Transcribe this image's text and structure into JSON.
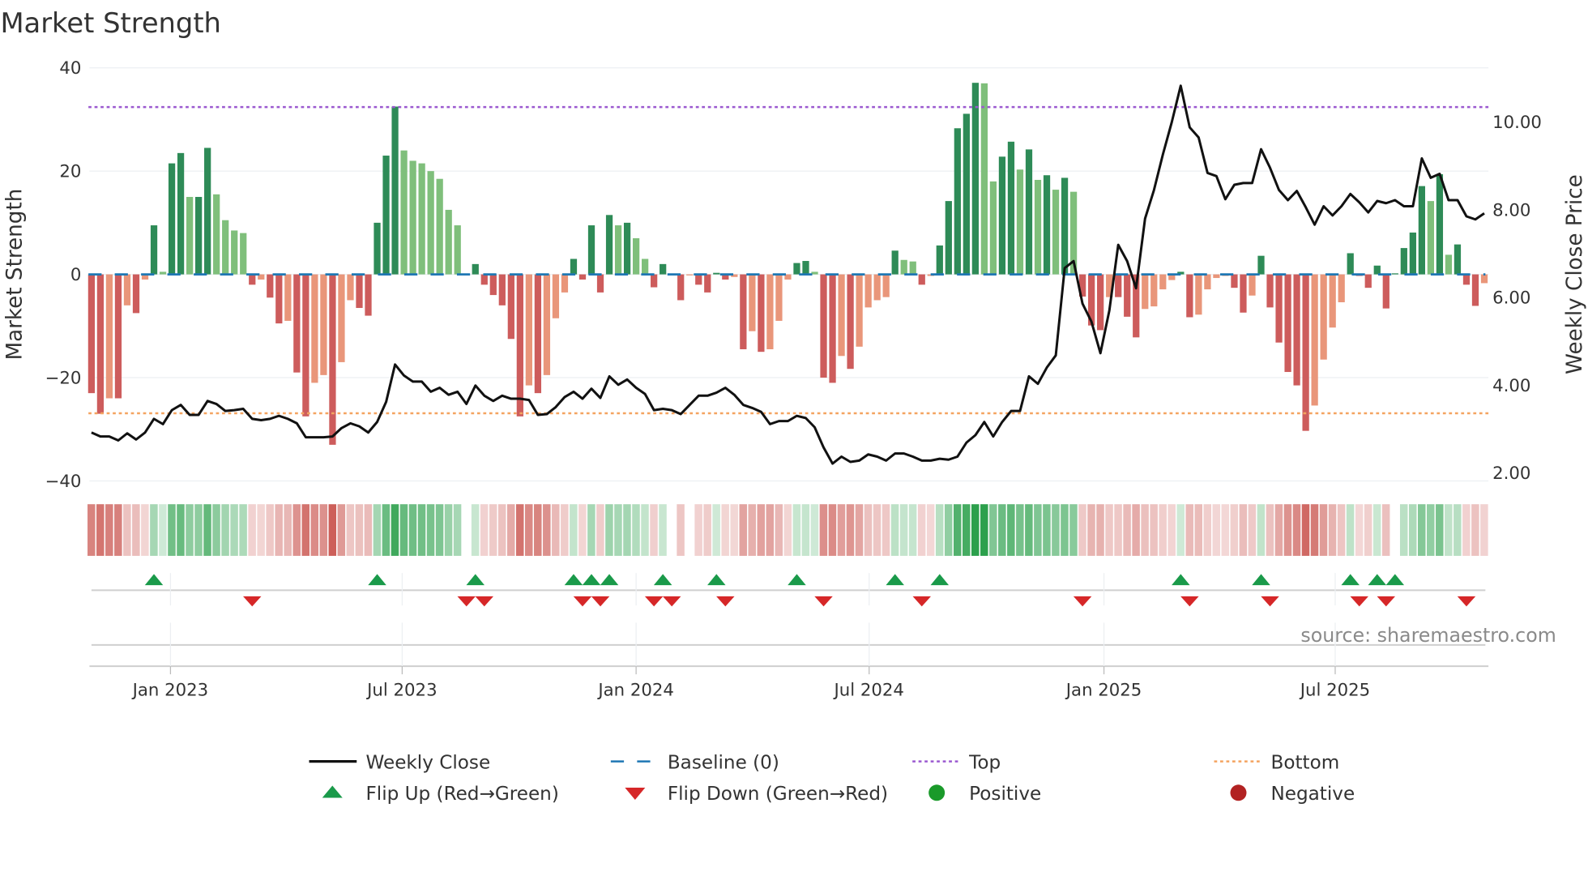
{
  "chart_data": {
    "type": "bar",
    "title": "Market Strength",
    "ylabel": "Market Strength",
    "y2label": "Weekly Close Price",
    "ylim": [
      -40,
      40
    ],
    "y_ticks": [
      {
        "v": 40,
        "label": "40"
      },
      {
        "v": 20,
        "label": "20"
      },
      {
        "v": 0,
        "label": "0"
      },
      {
        "v": -20,
        "label": "−20"
      },
      {
        "v": -40,
        "label": "−40"
      }
    ],
    "y2lim": [
      2.0,
      10.0
    ],
    "y2_ticks": [
      {
        "v": 10,
        "label": "10.00"
      },
      {
        "v": 8,
        "label": "8.00"
      },
      {
        "v": 6,
        "label": "6.00"
      },
      {
        "v": 4,
        "label": "4.00"
      },
      {
        "v": 2,
        "label": "2.00"
      }
    ],
    "x_ticks": [
      {
        "week": 8.85,
        "label": "Jan 2023"
      },
      {
        "week": 34.8,
        "label": "Jul 2023"
      },
      {
        "week": 61.0,
        "label": "Jan 2024"
      },
      {
        "week": 87.1,
        "label": "Jul 2024"
      },
      {
        "week": 113.4,
        "label": "Jan 2025"
      },
      {
        "week": 139.3,
        "label": "Jul 2025"
      }
    ],
    "top_level": 32.4,
    "bottom_level": -26.9,
    "baseline": 0,
    "strength": [
      -23,
      -27,
      -24,
      -24,
      -6,
      -7.5,
      -1,
      9.5,
      0.5,
      21.5,
      23.5,
      15,
      15,
      24.5,
      15.5,
      10.5,
      8.5,
      8,
      -2,
      -1,
      -4.5,
      -9.5,
      -9,
      -19,
      -27.5,
      -21,
      -19.5,
      -33,
      -17,
      -5,
      -6.5,
      -8,
      10,
      23,
      32.5,
      24,
      22,
      21.5,
      20,
      18.5,
      12.5,
      9.5,
      -0.2,
      2,
      -2,
      -4,
      -6,
      -12.5,
      -27.5,
      -21.5,
      -23,
      -19.5,
      -8.5,
      -3.5,
      3,
      -1,
      9.5,
      -3.5,
      11.5,
      9.5,
      10,
      7,
      3,
      -2.5,
      2,
      -0.2,
      -5,
      -0.2,
      -2,
      -3.5,
      0.3,
      -1,
      -0.5,
      -14.5,
      -11,
      -15,
      -14.5,
      -9,
      -1,
      2.2,
      2.6,
      0.5,
      -20,
      -21,
      -15.8,
      -18.3,
      -14,
      -6.4,
      -5,
      -4.4,
      4.6,
      2.8,
      2.5,
      -2,
      -0.3,
      5.6,
      14.2,
      28.3,
      31.1,
      37.1,
      37,
      18,
      22.8,
      25.7,
      20.3,
      24.2,
      18.3,
      19.2,
      16.4,
      18.7,
      16,
      -4.3,
      -9.9,
      -10.8,
      -4.4,
      -4.4,
      -8.2,
      -12.2,
      -6.7,
      -6.2,
      -2.9,
      -1.1,
      0.5,
      -8.3,
      -7.8,
      -2.9,
      -0.7,
      -0.3,
      -2.6,
      -7.4,
      -4.1,
      3.6,
      -6.4,
      -13.2,
      -18.9,
      -21.5,
      -30.3,
      -25.4,
      -16.5,
      -10.3,
      -5.4,
      4.1,
      -0.3,
      -2.6,
      1.7,
      -6.6,
      0.2,
      5.1,
      8.1,
      17.1,
      14.2,
      19.4,
      3.8,
      5.8,
      -2,
      -6.1,
      -1.7
    ],
    "weekly_close": [
      2.92,
      2.83,
      2.83,
      2.74,
      2.9,
      2.76,
      2.92,
      3.23,
      3.11,
      3.43,
      3.55,
      3.32,
      3.32,
      3.64,
      3.57,
      3.41,
      3.43,
      3.46,
      3.23,
      3.2,
      3.23,
      3.3,
      3.23,
      3.13,
      2.81,
      2.81,
      2.81,
      2.83,
      3.02,
      3.13,
      3.06,
      2.92,
      3.16,
      3.62,
      4.47,
      4.22,
      4.08,
      4.08,
      3.85,
      3.94,
      3.78,
      3.85,
      3.57,
      3.99,
      3.76,
      3.64,
      3.76,
      3.69,
      3.69,
      3.66,
      3.32,
      3.34,
      3.5,
      3.73,
      3.85,
      3.69,
      3.92,
      3.71,
      4.2,
      4.01,
      4.13,
      3.94,
      3.8,
      3.43,
      3.46,
      3.43,
      3.34,
      3.55,
      3.76,
      3.76,
      3.83,
      3.94,
      3.78,
      3.55,
      3.48,
      3.39,
      3.11,
      3.18,
      3.18,
      3.3,
      3.25,
      3.04,
      2.58,
      2.21,
      2.37,
      2.25,
      2.28,
      2.42,
      2.37,
      2.28,
      2.44,
      2.44,
      2.37,
      2.28,
      2.28,
      2.32,
      2.3,
      2.37,
      2.69,
      2.86,
      3.16,
      2.83,
      3.16,
      3.41,
      3.41,
      4.2,
      4.03,
      4.4,
      4.68,
      6.67,
      6.83,
      5.86,
      5.45,
      4.73,
      5.7,
      7.2,
      6.83,
      6.21,
      7.8,
      8.45,
      9.26,
      10.0,
      10.83,
      9.88,
      9.65,
      8.84,
      8.77,
      8.24,
      8.57,
      8.61,
      8.61,
      9.38,
      8.96,
      8.45,
      8.22,
      8.43,
      8.06,
      7.66,
      8.08,
      7.87,
      8.08,
      8.36,
      8.17,
      7.94,
      8.2,
      8.15,
      8.22,
      8.08,
      8.08,
      9.17,
      8.73,
      8.82,
      8.22,
      8.22,
      7.85,
      7.78,
      7.92
    ],
    "colors": {
      "pos_strong": "#2e8b57",
      "pos_weak": "#7fbf7b",
      "neg_strong": "#cd5c5c",
      "neg_weak": "#e9967a",
      "strip_pos": "#2ca04c",
      "strip_neg": "#c8504a",
      "flip_up": "#1a9a4a",
      "flip_down": "#d62728",
      "positive": "#1a9a2a",
      "negative": "#b22222",
      "top": "#9b59d0",
      "bottom": "#f4a460",
      "baseline": "#1f77b4",
      "close": "#111111"
    },
    "legend": {
      "placement": "bottom",
      "items": [
        "Weekly Close",
        "Baseline (0)",
        "Top",
        "Bottom",
        "Flip Up (Red→Green)",
        "Flip Down (Green→Red)",
        "Positive",
        "Negative"
      ]
    },
    "annotation": "source: sharemaestro.com"
  }
}
